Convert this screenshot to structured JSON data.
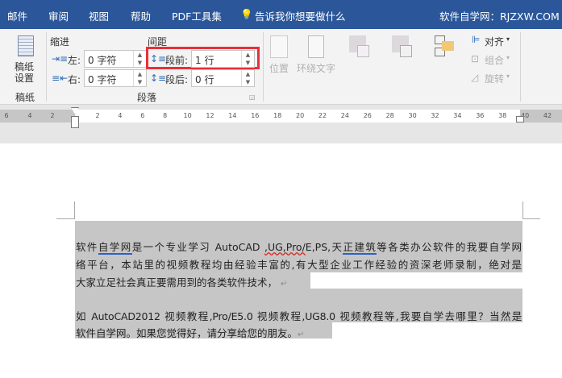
{
  "tabs": [
    "邮件",
    "审阅",
    "视图",
    "帮助",
    "PDF工具集"
  ],
  "tell_me": "告诉我你想要做什么",
  "brand": "软件自学网：RJZXW.COM",
  "ribbon": {
    "manuscript": {
      "button": "稿纸设置",
      "group": "稿纸"
    },
    "indent": {
      "title": "缩进",
      "left_label": "左:",
      "left_value": "0 字符",
      "right_label": "右:",
      "right_value": "0 字符"
    },
    "spacing": {
      "title": "间距",
      "before_label": "段前:",
      "before_value": "1 行",
      "after_label": "段后:",
      "after_value": "0 行"
    },
    "paragraph_group": "段落",
    "arrange": {
      "position": "位置",
      "wrap_text": "环绕文字",
      "align": "对齐",
      "group": "组合",
      "rotate": "旋转"
    }
  },
  "ruler": {
    "left": [
      "6",
      "4",
      "2"
    ],
    "right": [
      "2",
      "4",
      "6",
      "8",
      "10",
      "12",
      "14",
      "16",
      "18",
      "20",
      "22",
      "24",
      "26",
      "28",
      "30",
      "32",
      "34",
      "36",
      "38",
      "40",
      "42"
    ]
  },
  "document": {
    "p1": {
      "a": "软件",
      "b": "自学网",
      "c": "是一个专业学习 AutoCAD ",
      "d": ",UG,Pro/",
      "e": "E,PS,天",
      "f": "正建筑",
      "g": "等各类办公软件的我要自学网",
      "line2": "络平台，本站里的视频教程均由经验丰富的,有大型企业工作经验的资深老师录制，绝对是",
      "line3": "大家立足社会真正要需用到的各类软件技术，"
    },
    "p2": {
      "line1": "如 AutoCAD2012 视频教程,Pro/E5.0 视频教程,UG8.0 视频教程等,我要自学去哪里？当然是",
      "line2": "软件自学网。如果您觉得好，请分享给您的朋友。"
    },
    "para_mark": "↵"
  }
}
